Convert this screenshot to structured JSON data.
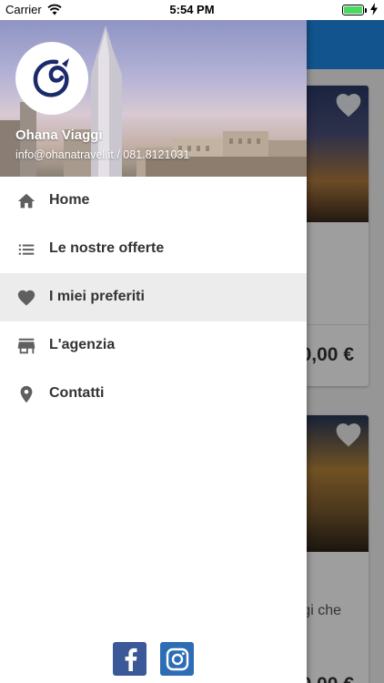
{
  "status_bar": {
    "carrier": "Carrier",
    "time": "5:54 PM",
    "battery_level": 1.0
  },
  "background": {
    "cards": [
      {
        "price": "0,00 €"
      },
      {
        "text": "gi che",
        "price": "0,00 €"
      }
    ]
  },
  "drawer": {
    "brand_name": "Ohana Viaggi",
    "contact": "info@ohanatravel.it / 081.8121031",
    "menu": [
      {
        "label": "Home",
        "icon": "home-icon",
        "active": false
      },
      {
        "label": "Le nostre offerte",
        "icon": "list-icon",
        "active": false
      },
      {
        "label": "I miei preferiti",
        "icon": "heart-icon",
        "active": true
      },
      {
        "label": "L'agenzia",
        "icon": "store-icon",
        "active": false
      },
      {
        "label": "Contatti",
        "icon": "location-pin-icon",
        "active": false
      }
    ],
    "social": [
      {
        "name": "facebook-icon",
        "letter": "f"
      },
      {
        "name": "instagram-icon"
      }
    ]
  },
  "colors": {
    "app_bar": "#1e88e5",
    "icon_gray": "#5f5f5f",
    "active_row": "#ececec",
    "facebook": "#3b5998",
    "instagram": "#2d6db5",
    "logo_navy": "#1b2a6b"
  }
}
